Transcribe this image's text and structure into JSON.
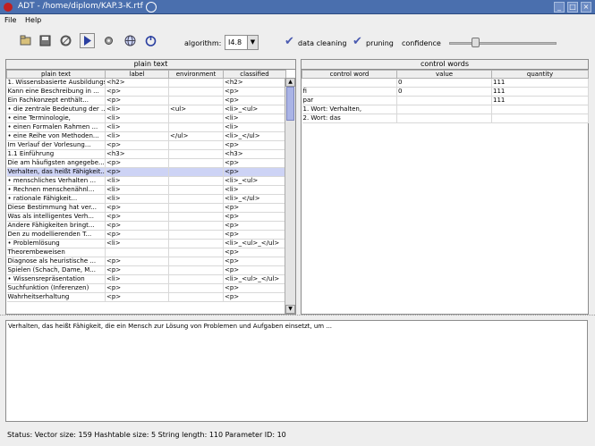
{
  "window": {
    "title": "ADT - /home/diplom/KAP.3-K.rtf",
    "buttons": [
      "_",
      "□",
      "×"
    ]
  },
  "menu": {
    "file": "File",
    "help": "Help"
  },
  "toolbar": {
    "algorithm_label": "algorithm:",
    "algorithm_value": "I4.8",
    "data_cleaning_label": "data cleaning",
    "pruning_label": "pruning",
    "confidence_label": "confidence",
    "confidence_level": 0.25
  },
  "plain_text": {
    "title": "plain text",
    "columns": [
      "plain text",
      "label",
      "environment",
      "classified"
    ],
    "rows": [
      [
        "1. Wissensbasierte Ausbildungsmodell",
        "<h2>",
        "",
        "<h2>"
      ],
      [
        "Kann eine Beschreibung in ...",
        "<p>",
        "",
        "<p>"
      ],
      [
        "Ein Fachkonzept enthält...",
        "<p>",
        "",
        "<p>"
      ],
      [
        "• die zentrale Bedeutung der ...",
        "<li>",
        "<ul>",
        "<li>_<ul>"
      ],
      [
        "• eine Terminologie,",
        "<li>",
        "",
        "<li>"
      ],
      [
        "• einen Formalen Rahmen ...",
        "<li>",
        "",
        "<li>"
      ],
      [
        "• eine Reihe von Methoden...",
        "<li>",
        "</ul>",
        "<li>_</ul>"
      ],
      [
        "Im Verlauf der Vorlesung...",
        "<p>",
        "",
        "<p>"
      ],
      [
        "1.1 Einführung",
        "<h3>",
        "",
        "<h3>"
      ],
      [
        "Die am häufigsten angegebe...",
        "<p>",
        "",
        "<p>"
      ],
      [
        "Verhalten, das heißt Fähigkeit...",
        "<p>",
        "",
        "<p>"
      ],
      [
        "• menschliches Verhalten ...",
        "<li>",
        "",
        "<li>_<ul>"
      ],
      [
        "• Rechnen menschenähnl...",
        "<li>",
        "",
        "<li>"
      ],
      [
        "• rationale Fähigkeit...",
        "<li>",
        "",
        "<li>_</ul>"
      ],
      [
        "Diese Bestimmung hat ver...",
        "<p>",
        "",
        "<p>"
      ],
      [
        "Was als intelligentes Verh...",
        "<p>",
        "",
        "<p>"
      ],
      [
        "Andere Fähigkeiten bringt...",
        "<p>",
        "",
        "<p>"
      ],
      [
        "Den zu modellierenden T...",
        "<p>",
        "",
        "<p>"
      ],
      [
        "• Problemlösung",
        "<li>",
        "",
        "<li>_<ul>_</ul>"
      ],
      [
        "Theorembeweisen",
        "",
        "",
        "<p>"
      ],
      [
        "Diagnose als heuristische ...",
        "<p>",
        "",
        "<p>"
      ],
      [
        "Spielen (Schach, Dame, M...",
        "<p>",
        "",
        "<p>"
      ],
      [
        "• Wissensrepräsentation",
        "<li>",
        "",
        "<li>_<ul>_</ul>"
      ],
      [
        "Suchfunktion (Inferenzen)",
        "<p>",
        "",
        "<p>"
      ],
      [
        "Wahrheitserhaltung",
        "<p>",
        "",
        "<p>"
      ]
    ],
    "highlighted_row": 10
  },
  "control_words": {
    "title": "control words",
    "columns": [
      "control word",
      "value",
      "quantity"
    ],
    "rows": [
      [
        "",
        "0",
        "111"
      ],
      [
        "fi",
        "0",
        "111"
      ],
      [
        "par",
        "",
        "111"
      ],
      [
        "1. Wort: Verhalten,",
        "",
        ""
      ],
      [
        "2. Wort: das",
        "",
        ""
      ]
    ]
  },
  "text_area": {
    "content": "Verhalten, das heißt Fähigkeit, die ein Mensch zur Lösung von Problemen und Aufgaben einsetzt, um ..."
  },
  "status": {
    "text": "Status:   Vector size: 159   Hashtable size: 5   String length: 110   Parameter ID: 10"
  }
}
